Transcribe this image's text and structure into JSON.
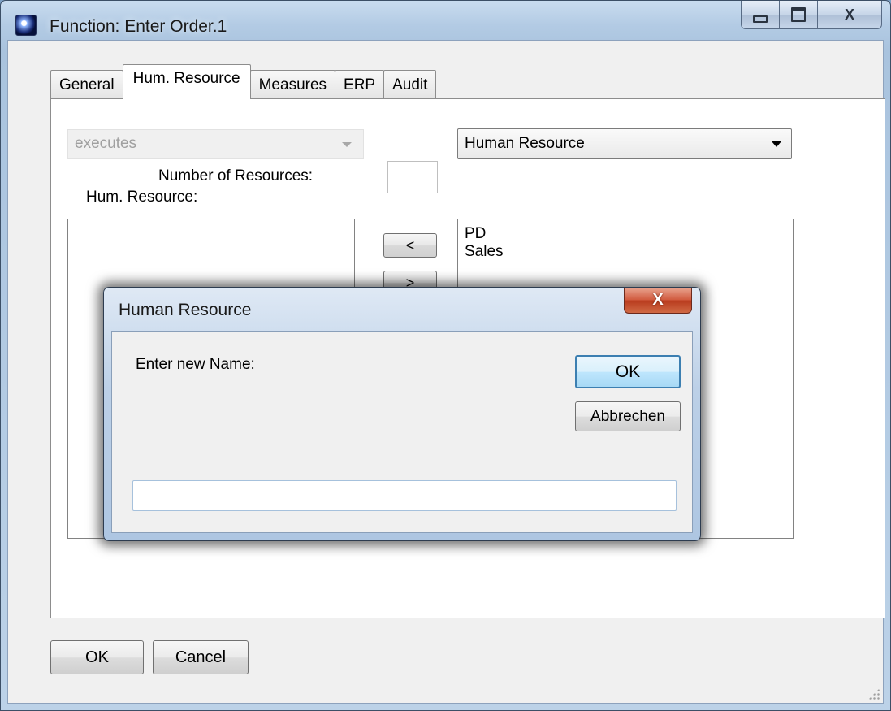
{
  "window": {
    "title": "Function: Enter Order.1",
    "icon": "app-icon",
    "controls": {
      "minimize": "minimize-icon",
      "maximize": "maximize-icon",
      "close": "X"
    }
  },
  "tabs": [
    {
      "label": "General",
      "active": false
    },
    {
      "label": "Hum. Resource",
      "active": true
    },
    {
      "label": "Measures",
      "active": false
    },
    {
      "label": "ERP",
      "active": false
    },
    {
      "label": "Audit",
      "active": false
    }
  ],
  "panel": {
    "relation_combo": {
      "value": "executes",
      "enabled": false
    },
    "number_of_resources_label": "Number of Resources:",
    "number_of_resources_value": "",
    "hum_resource_label": "Hum. Resource:",
    "type_combo": {
      "value": "Human Resource"
    },
    "assigned_list": [],
    "available_list": [
      "PD",
      "Sales"
    ],
    "move_left_label": "<",
    "move_right_label": ">"
  },
  "footer": {
    "ok_label": "OK",
    "cancel_label": "Cancel"
  },
  "dialog": {
    "title": "Human Resource",
    "close_label": "X",
    "prompt": "Enter new Name:",
    "ok_label": "OK",
    "cancel_label": "Abbrechen",
    "name_value": "",
    "name_placeholder": ""
  },
  "colors": {
    "window_frame": "#b3cbe4",
    "client_bg": "#f0f0f0",
    "dialog_close": "#c8472a",
    "default_button_border": "#3c7fb1"
  }
}
